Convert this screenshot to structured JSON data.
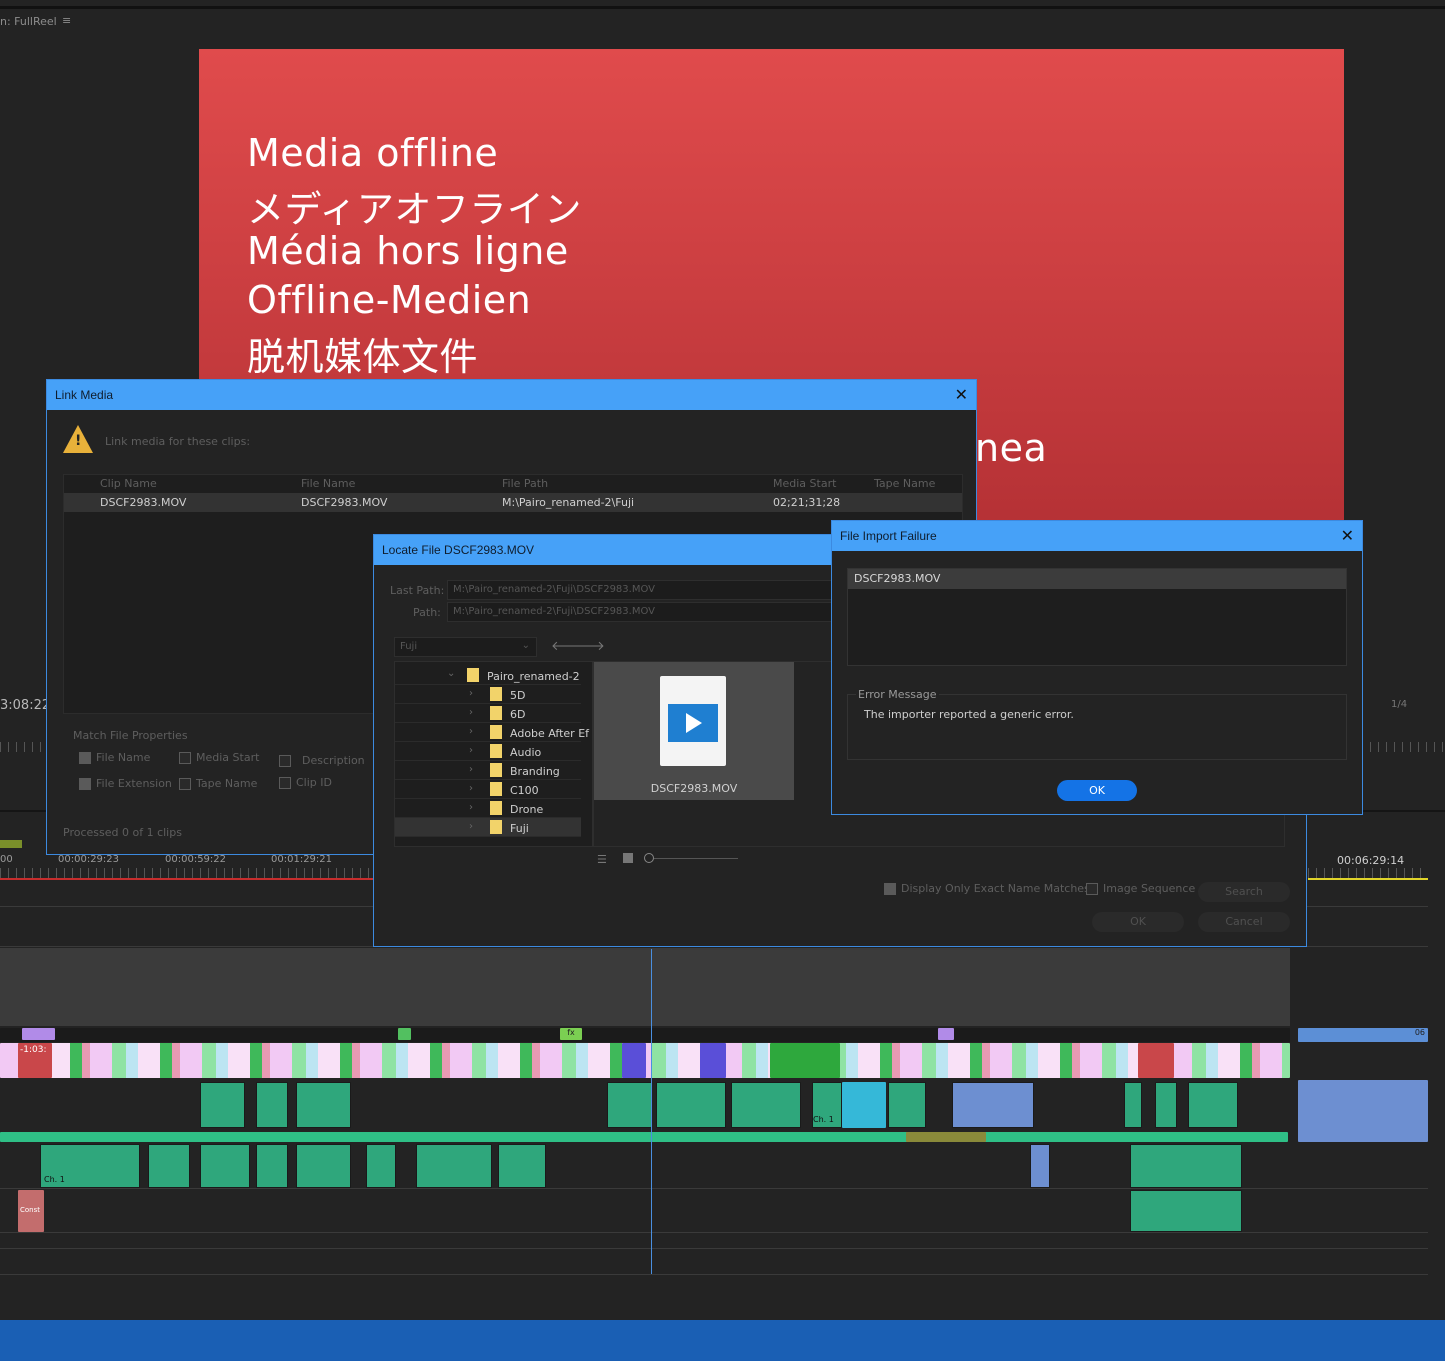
{
  "monitor": {
    "sequence_label": "n: FullReel",
    "offline_lines": [
      "Media offline",
      "メディアオフライン",
      "Média hors ligne",
      "Offline-Medien",
      "脱机媒体文件"
    ],
    "partial_line": "nea",
    "left_timecode": "3:08:22",
    "fraction": "1/4"
  },
  "timeline": {
    "timecodes": [
      "00",
      "00:00:29:23",
      "00:00:59:22",
      "00:01:29:21"
    ],
    "right_timecode": "00:06:29:14",
    "clip_label_ch": "Ch. 1",
    "clip_label_fx": "fx",
    "clip_label_time": "-1:03:",
    "clip_label_06": "06",
    "clip_label_const": "Const"
  },
  "link_media": {
    "title": "Link Media",
    "prompt": "Link media for these clips:",
    "columns": [
      "Clip Name",
      "File Name",
      "File Path",
      "Media Start",
      "Tape Name"
    ],
    "rows": [
      {
        "clip_name": "DSCF2983.MOV",
        "file_name": "DSCF2983.MOV",
        "file_path": "M:\\Pairo_renamed-2\\Fuji",
        "media_start": "02;21;31;28",
        "tape_name": ""
      }
    ],
    "match_group": "Match File Properties",
    "options": {
      "file_name": "File Name",
      "file_extension": "File Extension",
      "media_start": "Media Start",
      "tape_name": "Tape Name",
      "description": "Description",
      "clip_id": "Clip ID"
    },
    "status": "Processed 0 of 1 clips"
  },
  "locate_file": {
    "title": "Locate File DSCF2983.MOV",
    "last_path_label": "Last Path:",
    "last_path_value": "M:\\Pairo_renamed-2\\Fuji\\DSCF2983.MOV",
    "path_label": "Path:",
    "path_value": "M:\\Pairo_renamed-2\\Fuji\\DSCF2983.MOV",
    "folder_dropdown": "Fuji",
    "tree": {
      "root": "Pairo_renamed-2",
      "children": [
        "5D",
        "6D",
        "Adobe After Ef",
        "Audio",
        "Branding",
        "C100",
        "Drone",
        "Fuji"
      ]
    },
    "file_name": "DSCF2983.MOV",
    "exact_match_label": "Display Only Exact Name Matches",
    "image_sequence_label": "Image Sequence",
    "search_button": "Search",
    "ok_button": "OK",
    "cancel_button": "Cancel"
  },
  "import_failure": {
    "title": "File Import Failure",
    "file": "DSCF2983.MOV",
    "error_heading": "Error Message",
    "error_text": "The importer reported a generic error.",
    "ok_button": "OK",
    "accent": "#1473e6"
  },
  "colors": {
    "titlebar": "#46a1f8",
    "offline_red": "#e04b4c"
  }
}
